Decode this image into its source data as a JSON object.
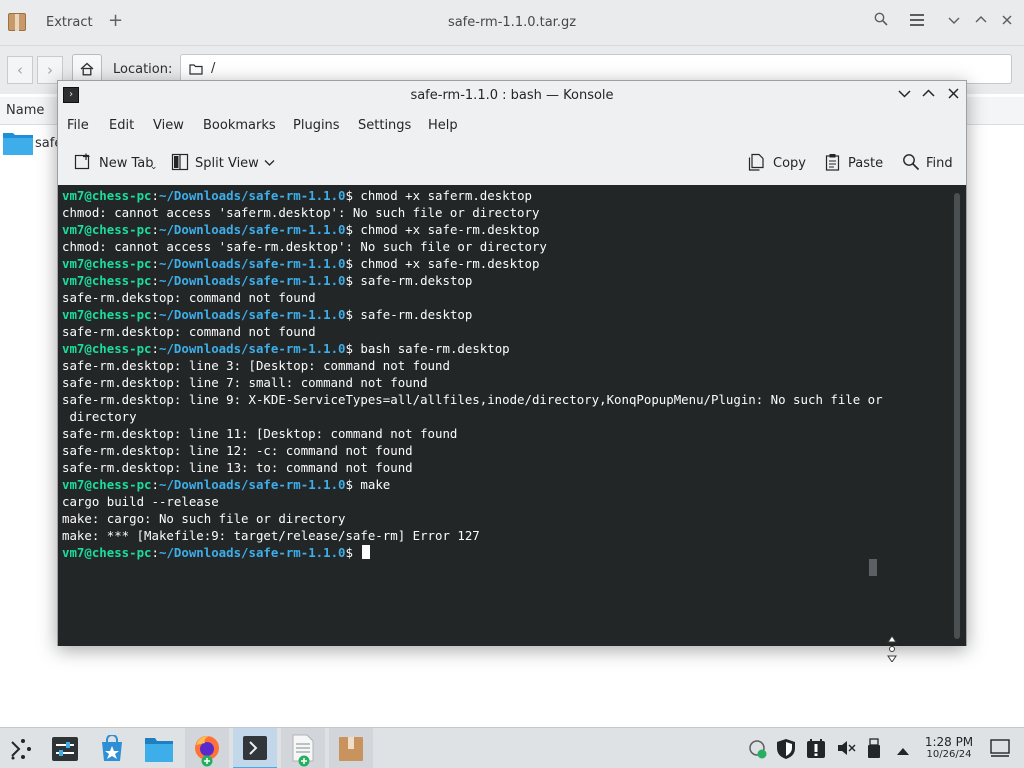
{
  "ark": {
    "tab_label": "Extract",
    "new_tab_symbol": "+",
    "title": "safe-rm-1.1.0.tar.gz",
    "location_label": "Location:",
    "location_value": "/",
    "column_name": "Name",
    "items": [
      {
        "label": "safe"
      }
    ]
  },
  "konsole": {
    "title": "safe-rm-1.1.0 : bash — Konsole",
    "menu": [
      "File",
      "Edit",
      "View",
      "Bookmarks",
      "Plugins",
      "Settings",
      "Help"
    ],
    "toolbar": {
      "new_tab": "New Tab",
      "split_view": "Split View",
      "copy": "Copy",
      "paste": "Paste",
      "find": "Find"
    },
    "prompt": {
      "user": "vm7@chess-pc",
      "path": "~/Downloads/safe-rm-1.1.0"
    },
    "lines": [
      {
        "type": "cmd",
        "text": " chmod +x saferm.desktop"
      },
      {
        "type": "out",
        "text": "chmod: cannot access 'saferm.desktop': No such file or directory"
      },
      {
        "type": "cmd",
        "text": " chmod +x safe-rm.desktop"
      },
      {
        "type": "out",
        "text": "chmod: cannot access 'safe-rm.desktop': No such file or directory"
      },
      {
        "type": "cmd",
        "text": " chmod +x safe-rm.desktop"
      },
      {
        "type": "cmd",
        "text": " safe-rm.dekstop"
      },
      {
        "type": "out",
        "text": "safe-rm.dekstop: command not found"
      },
      {
        "type": "cmd",
        "text": " safe-rm.desktop"
      },
      {
        "type": "out",
        "text": "safe-rm.desktop: command not found"
      },
      {
        "type": "cmd",
        "text": " bash safe-rm.desktop"
      },
      {
        "type": "out",
        "text": "safe-rm.desktop: line 3: [Desktop: command not found"
      },
      {
        "type": "out",
        "text": "safe-rm.desktop: line 7: small: command not found"
      },
      {
        "type": "out",
        "text": "safe-rm.desktop: line 9: X-KDE-ServiceTypes=all/allfiles,inode/directory,KonqPopupMenu/Plugin: No such file or"
      },
      {
        "type": "out",
        "text": " directory"
      },
      {
        "type": "out",
        "text": "safe-rm.desktop: line 11: [Desktop: command not found"
      },
      {
        "type": "out",
        "text": "safe-rm.desktop: line 12: -c: command not found"
      },
      {
        "type": "out",
        "text": "safe-rm.desktop: line 13: to: command not found"
      },
      {
        "type": "cmd",
        "text": " make"
      },
      {
        "type": "out",
        "text": "cargo build --release"
      },
      {
        "type": "out",
        "text": "make: cargo: No such file or directory"
      },
      {
        "type": "out",
        "text": "make: *** [Makefile:9: target/release/safe-rm] Error 127"
      },
      {
        "type": "cursor",
        "text": " "
      }
    ]
  },
  "taskbar": {
    "time": "1:28 PM",
    "date": "10/26/24",
    "apps": [
      "application-launcher-icon",
      "system-settings-icon",
      "discover-icon",
      "dolphin-icon",
      "firefox-icon",
      "konsole-icon",
      "text-editor-icon",
      "ark-icon"
    ]
  },
  "colors": {
    "terminal_bg": "#232627",
    "prompt_user": "#1cdc9a",
    "prompt_path": "#3daee9",
    "accent": "#3daee9"
  }
}
